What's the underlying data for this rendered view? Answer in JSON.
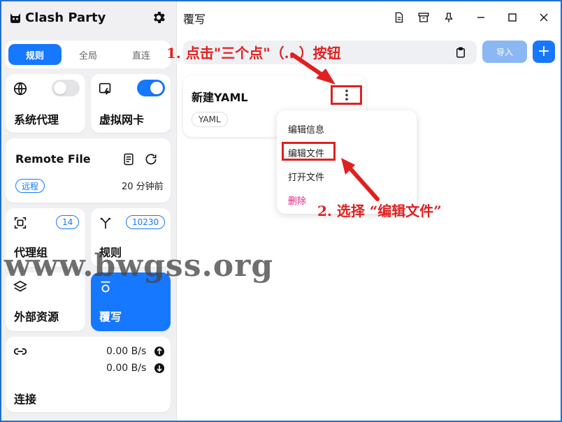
{
  "app": {
    "title": "Clash Party"
  },
  "modes": [
    {
      "label": "规则",
      "active": true
    },
    {
      "label": "全局",
      "active": false
    },
    {
      "label": "直连",
      "active": false
    }
  ],
  "cards": {
    "system_proxy": {
      "label": "系统代理",
      "enabled": false
    },
    "tun": {
      "label": "虚拟网卡",
      "enabled": true
    },
    "remote_file": {
      "label": "Remote File",
      "badge": "远程",
      "updated": "20 分钟前"
    },
    "proxy_groups": {
      "label": "代理组",
      "count": "14"
    },
    "rules": {
      "label": "规则",
      "count": "10230"
    },
    "external_resources": {
      "label": "外部资源"
    },
    "override": {
      "label": "覆写"
    },
    "connections": {
      "label": "连接",
      "upload": "0.00 B/s",
      "download": "0.00 B/s"
    }
  },
  "main": {
    "title": "覆写",
    "import_label": "导入",
    "add_label": "+",
    "profile": {
      "name": "新建YAML",
      "type": "YAML"
    },
    "menu": [
      "编辑信息",
      "编辑文件",
      "打开文件",
      "删除"
    ]
  },
  "annotations": {
    "step1": "1. 点击\"三个点\"（...）按钮",
    "step2": "2. 选择 “编辑文件”"
  },
  "watermark": "www.bwgss.org",
  "colors": {
    "accent": "#1677ff",
    "annotation_red": "#e02020",
    "danger": "#e0227e"
  }
}
